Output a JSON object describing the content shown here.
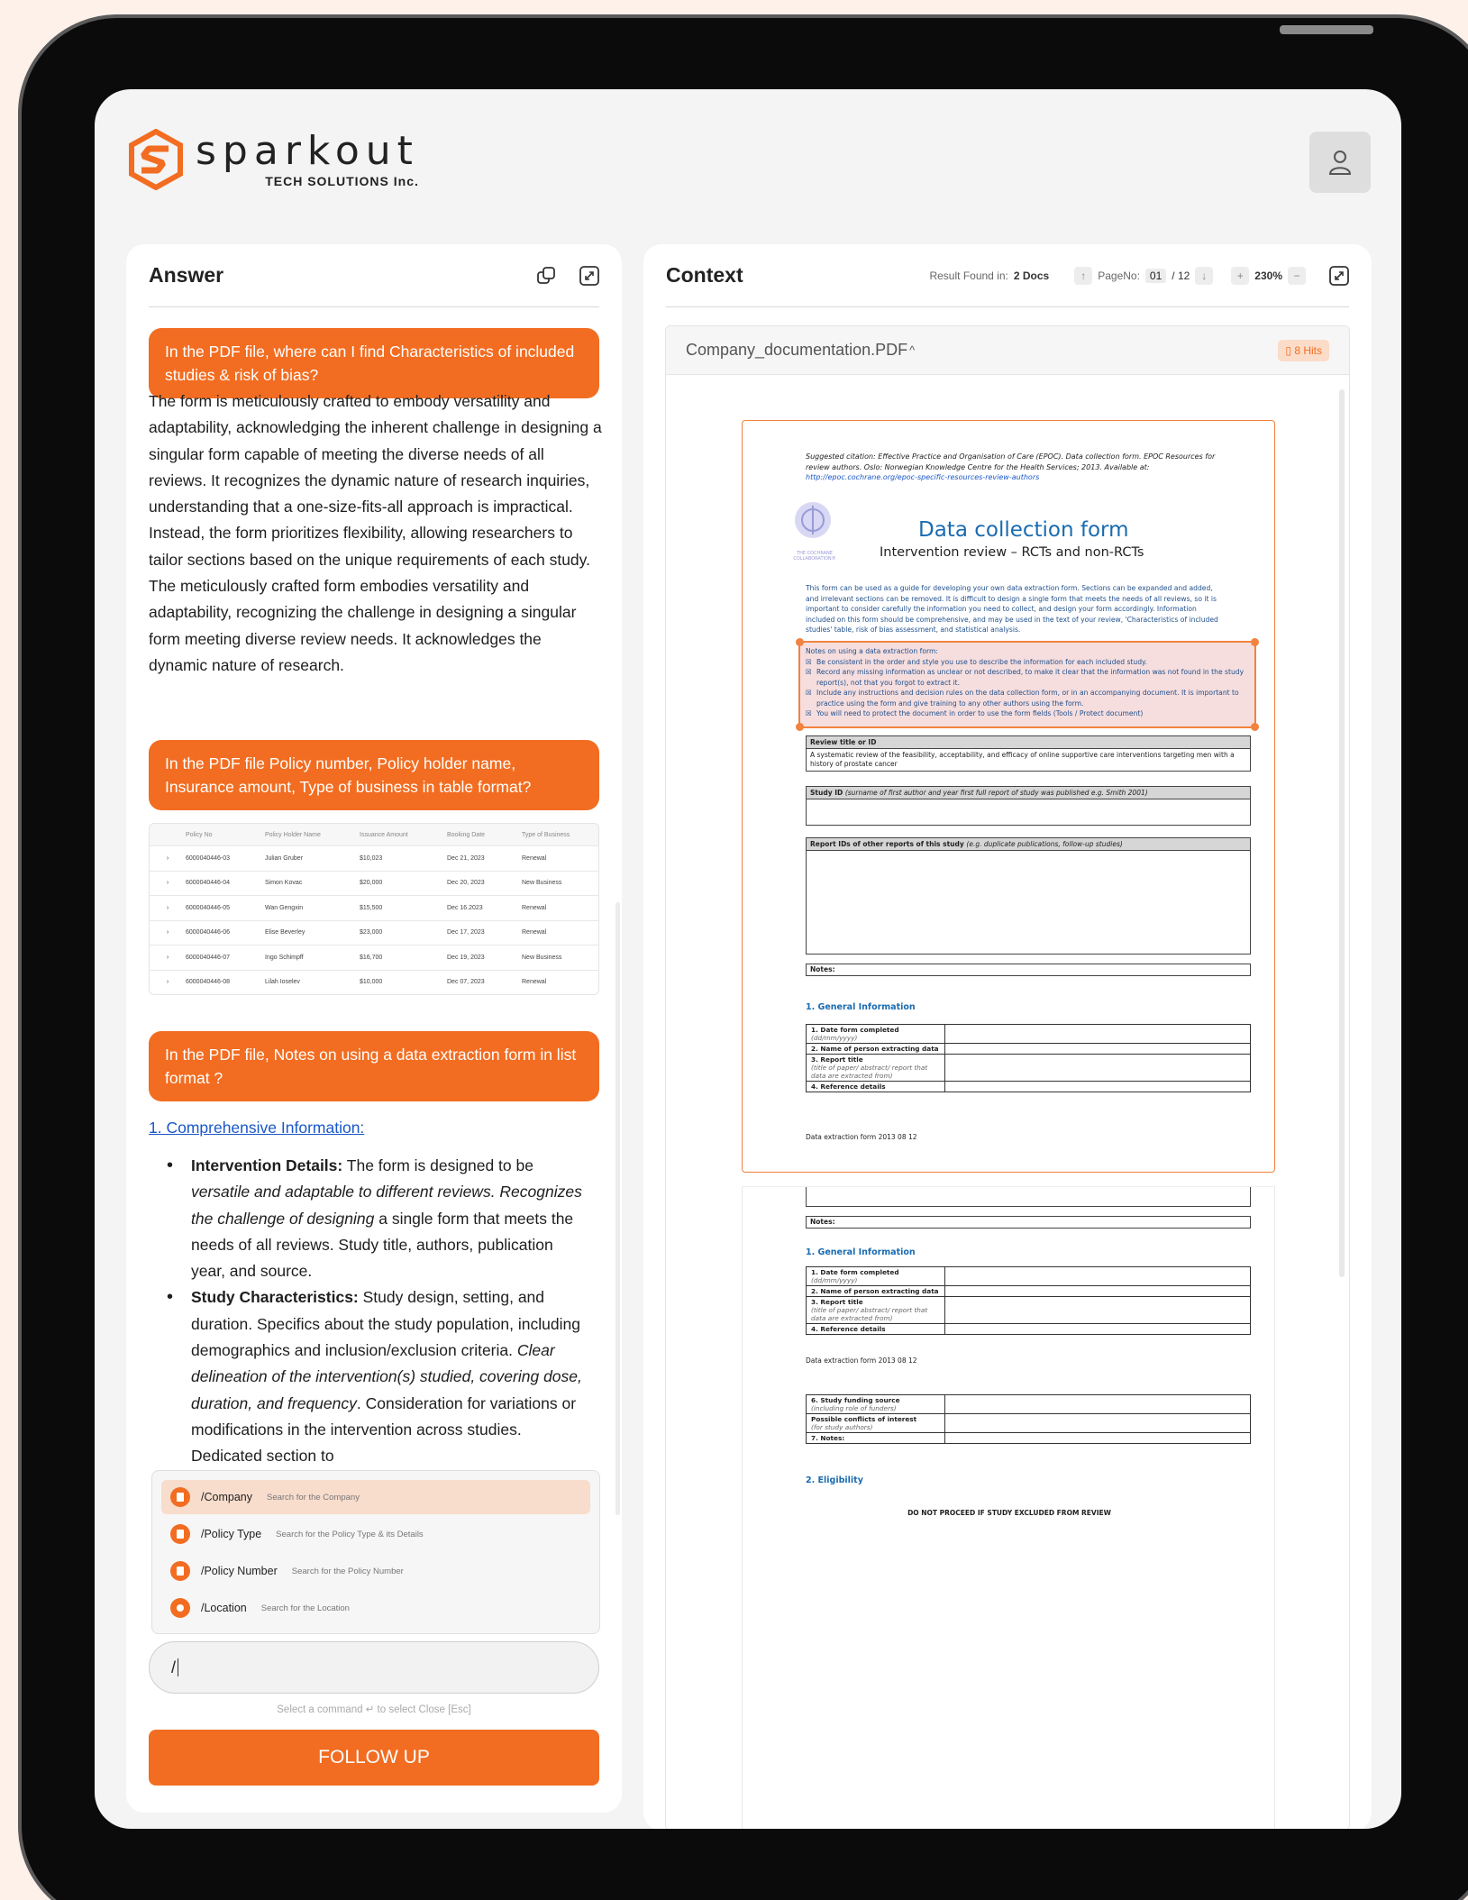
{
  "brand": {
    "name": "sparkout",
    "sub": "TECH SOLUTIONS Inc."
  },
  "answer": {
    "title": "Answer",
    "q1": "In the PDF file, where can I find Characteristics of included studies & risk of bias?",
    "a1": "The form is meticulously crafted to embody versatility and adaptability, acknowledging the inherent challenge in designing a singular form capable of meeting the diverse needs of all reviews. It recognizes the dynamic nature of research inquiries, understanding that a one-size-fits-all approach is impractical. Instead, the form prioritizes flexibility, allowing researchers to tailor sections based on the unique requirements of each study.",
    "a1b": "The meticulously crafted form embodies versatility and adaptability, recognizing the challenge in designing a singular form meeting diverse review needs. It acknowledges the dynamic nature of research.",
    "q2": "In the PDF file Policy number, Policy holder name, Insurance amount, Type of business in table format?",
    "table": {
      "headers": [
        "Policy No",
        "Policy Holder Name",
        "Issuance Amount",
        "Booking Date",
        "Type of Business"
      ],
      "rows": [
        [
          "6000040446-03",
          "Julian Gruber",
          "$10,023",
          "Dec 21, 2023",
          "Renewal"
        ],
        [
          "6000040446-04",
          "Simon Kovac",
          "$20,000",
          "Dec 20, 2023",
          "New Business"
        ],
        [
          "6000040446-05",
          "Wan Gengxin",
          "$15,500",
          "Dec 16.2023",
          "Renewal"
        ],
        [
          "6000040446-06",
          "Elise Beverley",
          "$23,000",
          "Dec 17, 2023",
          "Renewal"
        ],
        [
          "6000040446-07",
          "Ingo Schimpff",
          "$16,700",
          "Dec 19, 2023",
          "New Business"
        ],
        [
          "6000040446-08",
          "Lilah Ioselev",
          "$10,000",
          "Dec 07, 2023",
          "Renewal"
        ]
      ]
    },
    "q3": "In the PDF file, Notes on using a data extraction form in list format ?",
    "list_link": "1. Comprehensive Information:",
    "b1_label": "Intervention Details:",
    "b1_t1": " The form is designed to be ",
    "b1_i1": "versatile and adaptable to different reviews. Recognizes the challenge of designing",
    "b1_t2": " a single form that meets the needs of all reviews. Study title, authors, publication year, and source.",
    "b2_label": "Study Characteristics:",
    "b2_t1": " Study design, setting, and duration. Specifics about the study population, including demographics and inclusion/exclusion criteria. ",
    "b2_i1": "Clear delineation of the intervention(s) studied, covering dose, duration, and frequency",
    "b2_t2": ". Consideration for variations or modifications in the intervention across studies. Dedicated section to",
    "commands": [
      {
        "name": "/Company",
        "desc": "Search for the Company"
      },
      {
        "name": "/Policy Type",
        "desc": "Search for the Policy Type & its Details"
      },
      {
        "name": "/Policy Number",
        "desc": "Search for the Policy Number"
      },
      {
        "name": "/Location",
        "desc": "Search for the Location"
      }
    ],
    "input_value": "/",
    "hint": "Select a command  ↵  to select Close [Esc]",
    "follow_up": "FOLLOW UP"
  },
  "context": {
    "title": "Context",
    "result_label": "Result Found in:",
    "result_value": "2 Docs",
    "page_label": "PageNo:",
    "page_current": "01",
    "page_total": "/ 12",
    "zoom": "230%",
    "file_name": "Company_documentation.PDF",
    "hits": "8 Hits"
  },
  "doc": {
    "cite1": "Suggested citation: Effective Practice and Organisation of Care (EPOC). Data collection form. EPOC Resources for review authors. Oslo: Norwegian Knowledge Centre for the Health Services; 2013. Available at:",
    "cite_link": "http://epoc.cochrane.org/epoc-specific-resources-review-authors",
    "seal_text": "THE COCHRANE COLLABORATION®",
    "title": "Data collection form",
    "subtitle": "Intervention review – RCTs and non-RCTs",
    "intro": "This form can be used as a guide for developing your own data extraction form. Sections can be expanded and added, and irrelevant sections can be removed. It is difficult to design a single form that meets the needs of all reviews, so it is important to consider carefully the information you need to collect, and design your form accordingly. Information included on this form should be comprehensive, and may be used in the text of your review, 'Characteristics of included studies' table, risk of bias assessment, and statistical analysis.",
    "notes_head": "Notes on using a data extraction form:",
    "notes": [
      "Be consistent in the order and style you use to describe the information for each included study.",
      "Record any missing information as unclear or not described, to make it clear that the information was not found in the study report(s), not that you forgot to extract it.",
      "Include any instructions and decision rules on the data collection form, or in an accompanying document. It is important to practice using the form and give training to any other authors using the form.",
      "You will need to protect the document in order to use the form fields (Tools / Protect document)"
    ],
    "review_title_head": "Review title or ID",
    "review_title_body": "A systematic review of the feasibility, acceptability, and efficacy of online supportive care interventions targeting men with a history of prostate cancer",
    "study_id_head": "Study ID",
    "study_id_note": "(surname of first author and year first full report of study was published e.g. Smith 2001)",
    "report_ids_head": "Report IDs of other reports of this study",
    "report_ids_note": "(e.g. duplicate publications, follow-up studies)",
    "notes_label": "Notes:",
    "gen_info": "1.  General Information",
    "gi_rows": [
      {
        "label": "1.  Date form completed",
        "sub": "(dd/mm/yyyy)"
      },
      {
        "label": "2.  Name of person extracting data",
        "sub": ""
      },
      {
        "label": "3.  Report title",
        "sub": "(title of paper/ abstract/ report that data are extracted from)"
      },
      {
        "label": "4.  Reference details",
        "sub": ""
      }
    ],
    "footer": "Data extraction form 2013 08 12",
    "p2_rows": [
      {
        "label": "6.  Study funding source",
        "sub": "(including role of funders)"
      },
      {
        "label": "Possible conflicts of interest",
        "sub": "(for study authors)"
      },
      {
        "label": "7.  Notes:",
        "sub": ""
      }
    ],
    "eligibility": "2.  Eligibility",
    "do_not": "DO NOT PROCEED IF STUDY EXCLUDED FROM REVIEW"
  },
  "colors": {
    "accent": "#f26d21",
    "highlight": "#f6dede",
    "link": "#1a57c8",
    "doc_blue": "#1a6bb0"
  }
}
